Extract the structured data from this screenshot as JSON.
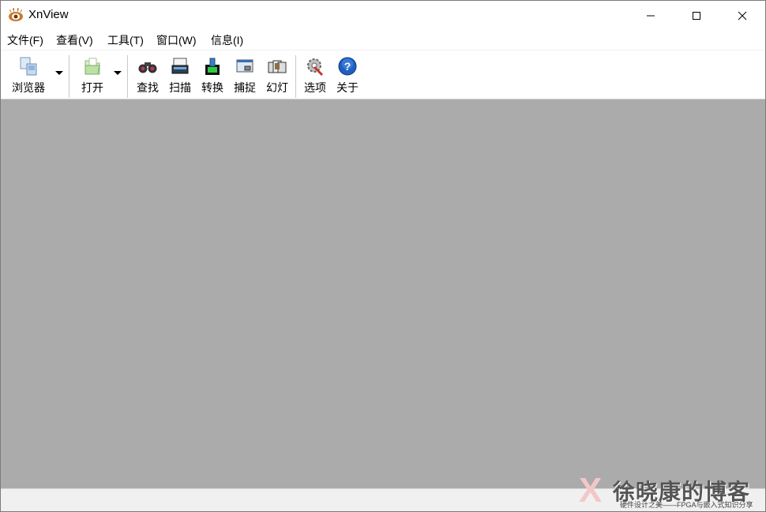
{
  "window": {
    "title": "XnView"
  },
  "menu": [
    "文件(F)",
    "查看(V)",
    "工具(T)",
    "窗口(W)",
    "信息(I)"
  ],
  "toolbar": {
    "browser": "浏览器",
    "open": "打开",
    "find": "查找",
    "scan": "扫描",
    "convert": "转换",
    "capture": "捕捉",
    "slideshow": "幻灯",
    "options": "选项",
    "about": "关于"
  },
  "watermark": {
    "mark": "X",
    "title": "徐晓康的博客",
    "subtitle": "硬件设计之美——FPGA与嵌入式知识分享"
  },
  "colors": {
    "workspace": "#ababab",
    "statusbar": "#f0f0f0"
  }
}
